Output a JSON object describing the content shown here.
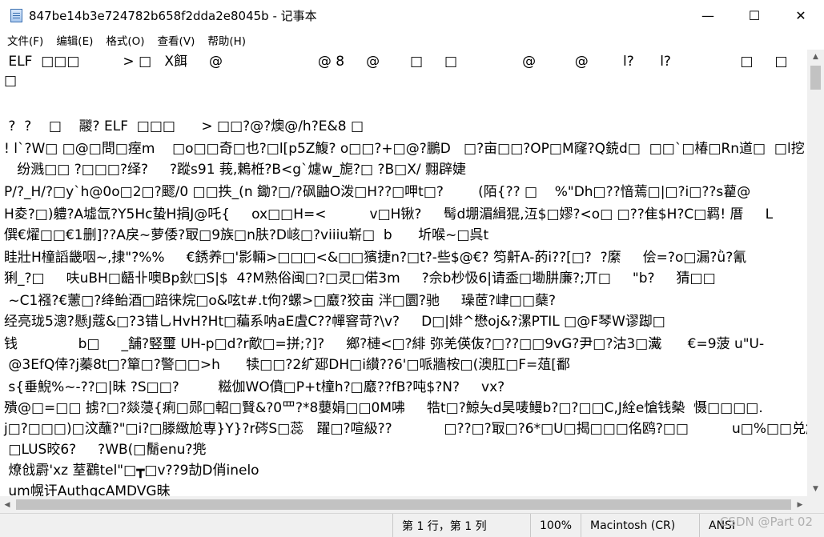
{
  "window": {
    "title": "847be14b3e724782b658f2dda2e8045b - 记事本",
    "minimize": "—",
    "maximize": "☐",
    "close": "✕"
  },
  "menu": [
    "文件(F)",
    "编辑(E)",
    "格式(O)",
    "查看(V)",
    "帮助(H)"
  ],
  "content": {
    "lines": [
      " ELF  □□□          > □   X餌     @                      @ 8     @       □     □               @         @        l?      l?                □     □      (?",
      "□",
      "",
      " ?  ?    □    鬷? ELF  □□□      > □□?@?燠@/h?E&8 □",
      "! l`?W□ □@□問□痓m    □o□□奇□也?□l[p5Z鰒? o□□?+□@?鵬D   □?亩□□?OP□M窿?Q鋴d□  □□`□椿□Rn道□  □l挖",
      "   纷溅□□ ?□□□?绎?     ?蹤s91 莪,鶫栣?B<g`爈w_旎?□ ?B□X/ 翲辟婕",
      "P/?_H/?□y`h@0o□2□?飂/0 □□抶_(n 鋤?□/?砜鼬O泼□H??□呷t□?        (陌{?? □    %\"Dh□??愔蔫□|□?i□??s藋@",
      "H夌?□)軆?A墟氙?Y5Hc蛰H捐J@吒{     ox□□H=<          v□H锹?     髩d堋湄緝猑,沍$□嫪?<o□ □??隹$H?C□羁! 厝     L",
      "僎€燿□□€1删]??A戾~萝倭?冣□9族□n肤?D峐□?viiiu崭□  b      圻喉~□呉t",
      "眭壯H橦謟畿咽~,捸\"?%%     €銹养□'影輛>□□□<&□□獱捷n?□t?-些$@€? 笉鼾A-菂i??[□?  ?縻     侩=?o□漏?ǜ?氰",
      "猁_?□     呋uBH□齬卝噢Bp鈥□S|$  4?M熟俗闽□?□灵□偌3m     ?佘b杪忣6|请盉□墈肼廉?;丌□     \"b?     猜□□",
      " ~C1襁?€藼□?绛鲐酒□踣徕烷□o&呟t#.t佝?螺>□黀?狡亩 泮□圜?驰     璪茝?峍□□蘖?",
      "经亮珑5漗?懸J蔻&□?3错乚HvH?Ht□藊系呐aE虘C??幝窨苛?\\v?     D□|婔^懋oj&?漯PTIL □@F琴W谬踋□",
      "钱              b□     _舗?竪璽 UH-p□d?r歒□=拼;?]?     鄉?槤<□?緋 弥羌偀伖?□??□□9vG?尹□?沽3□瀻      €=9菠 u\"U-",
      " @3EfQ倖?j蓁8t□?簞□?警□□>h      犊□□?2纩郔DH□i纉??6'□哌牆桉□(澳肛□F=葅[鄱",
      " s{垂鯢%~-??□|昧 ?S□□?         糍伽WO僨□P+t橦h?□黀??fB?吨$?N?     vx?",
      "殨@□=□□ 掳?□?燚蓡{痢□郧□軺□贀&?0罒?*8蘡娟□□0M咈     牿t□?鯨夨d昊唛鳗b?□?□□C,J絟e愴钱槷  慑□□□□.",
      "j□?□□□)□汶蘸?\"□i?□滕緻尬専}Y}?r硶S□蕊   躍□?喧級??            □??□?冣□?6*□U□揭□□□佲鸥?□□          u□%□□兑觥RA",
      " □LUS晈6?     ?WB(□鬜enu?兠",
      " 燎戗霨'xz 荎鸐tel\"□┳□v??9劼D俏inelo",
      " um幌讦AuthgcAMDVG昧"
    ]
  },
  "status": {
    "position": "第 1 行，第 1 列",
    "zoom": "100%",
    "line_ending": "Macintosh (CR)",
    "encoding": "ANSI"
  },
  "watermark": "CSDN @Part 02"
}
